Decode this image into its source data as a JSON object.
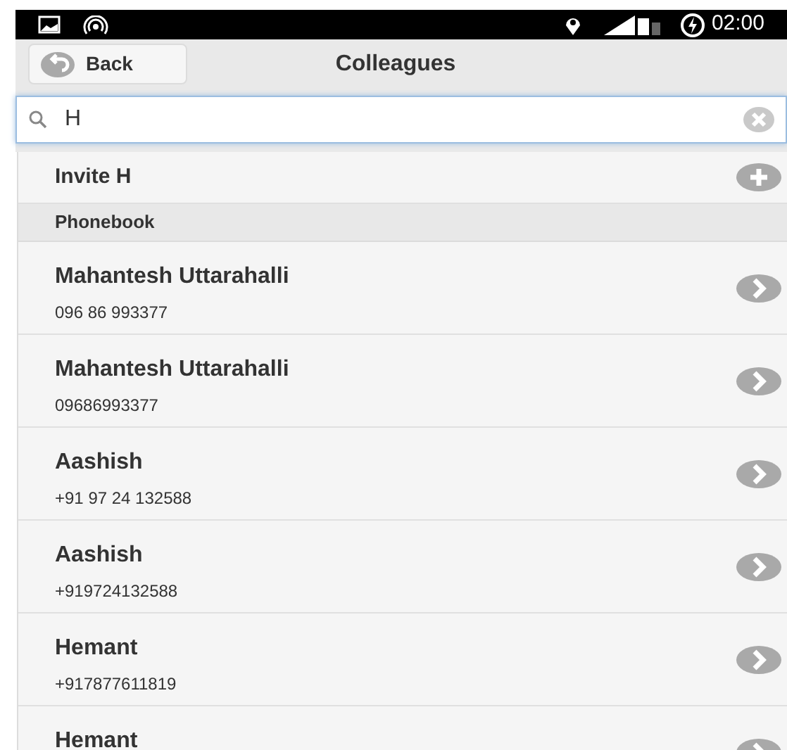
{
  "status_bar": {
    "time": "02:00"
  },
  "header": {
    "back_label": "Back",
    "title": "Colleagues"
  },
  "search": {
    "value": "H"
  },
  "invite": {
    "label": "Invite H"
  },
  "section": {
    "title": "Phonebook"
  },
  "contacts": [
    {
      "name": "Mahantesh Uttarahalli",
      "number": "096 86 993377"
    },
    {
      "name": "Mahantesh Uttarahalli",
      "number": "09686993377"
    },
    {
      "name": "Aashish",
      "number": "+91 97 24 132588"
    },
    {
      "name": "Aashish",
      "number": "+919724132588"
    },
    {
      "name": "Hemant",
      "number": "+917877611819"
    },
    {
      "name": "Hemant"
    }
  ]
}
